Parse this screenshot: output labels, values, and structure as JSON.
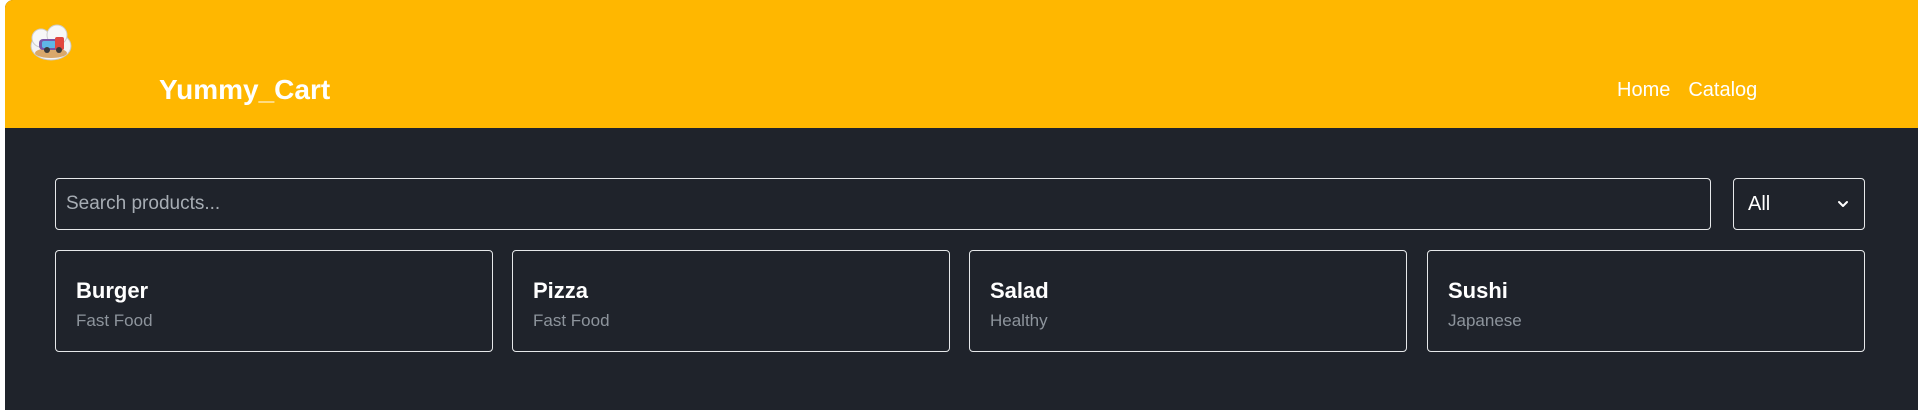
{
  "navbar": {
    "brand": "Yummy_Cart",
    "links": [
      {
        "label": "Home"
      },
      {
        "label": "Catalog"
      }
    ],
    "background_color": "#ffb700",
    "logo_icon": "food-cloud-logo-icon"
  },
  "search": {
    "placeholder": "Search products...",
    "value": ""
  },
  "category_filter": {
    "selected": "All"
  },
  "products": [
    {
      "name": "Burger",
      "category": "Fast Food"
    },
    {
      "name": "Pizza",
      "category": "Fast Food"
    },
    {
      "name": "Salad",
      "category": "Healthy"
    },
    {
      "name": "Sushi",
      "category": "Japanese"
    }
  ],
  "colors": {
    "page_background": "#1f232b",
    "border": "#e6e8ea",
    "muted_text": "#8d949c"
  }
}
